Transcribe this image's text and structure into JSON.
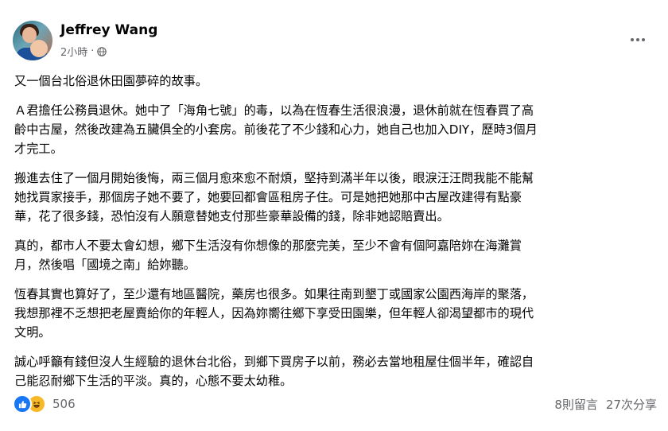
{
  "post": {
    "author": "Jeffrey Wang",
    "time": "2小時",
    "separator": "·",
    "paragraphs": [
      "又一個台北俗退休田園夢碎的故事。",
      "Ａ君擔任公務員退休。她中了「海角七號」的毒，以為在恆春生活很浪漫，退休前就在恆春買了高\n齡中古屋，然後改建為五臟俱全的小套房。前後花了不少錢和心力，她自己也加入DIY，歷時3個月\n才完工。",
      "搬進去住了一個月開始後悔，兩三個月愈來愈不耐煩，堅持到滿半年以後，眼淚汪汪問我能不能幫\n她找買家接手，那個房子她不要了，她要回都會區租房子住。可是她把她那中古屋改建得有點豪\n華，花了很多錢，恐怕沒有人願意替她支付那些豪華設備的錢，除非她認賠賣出。",
      "真的，都市人不要太會幻想，鄉下生活沒有你想像的那麼完美，至少不會有個阿嘉陪妳在海灘賞\n月，然後唱「國境之南」給妳聽。",
      "恆春其實也算好了，至少還有地區醫院，藥房也很多。如果往南到墾丁或國家公園西海岸的聚落，\n我想那裡不乏想把老屋賣給你的年輕人，因為妳嚮往鄉下享受田園樂，但年輕人卻渴望都市的現代\n文明。",
      "誠心呼籲有錢但沒人生經驗的退休台北俗，到鄉下買房子以前，務必去當地租屋住個半年，確認自\n己能忍耐鄉下生活的平淡。真的，心態不要太幼稚。"
    ]
  },
  "footer": {
    "reaction_count": "506",
    "comments": "8則留言",
    "shares": "27次分享"
  },
  "icons": {
    "more": "more-horizontal-icon",
    "audience": "globe-icon",
    "like": "like-icon",
    "haha": "haha-icon"
  },
  "colors": {
    "like": "#1877f2",
    "haha": "#f7b928",
    "secondary_text": "#65676b"
  }
}
